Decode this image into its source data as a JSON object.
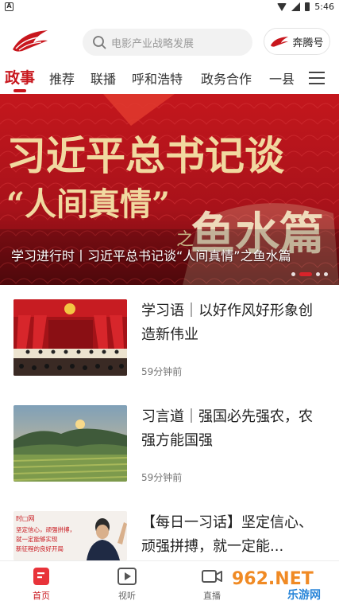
{
  "status_bar": {
    "carrier_badge": "A",
    "time": "5:46"
  },
  "header": {
    "search_placeholder": "电影产业战略发展",
    "benteng_label": "奔腾号"
  },
  "nav": {
    "tabs": [
      {
        "label": "政事",
        "active": true
      },
      {
        "label": "推荐",
        "active": false
      },
      {
        "label": "联播",
        "active": false
      },
      {
        "label": "呼和浩特",
        "active": false
      },
      {
        "label": "政务合作",
        "active": false
      },
      {
        "label": "一县",
        "active": false
      }
    ],
    "menu_icon": "menu-icon"
  },
  "banner": {
    "art_line1": "习近平总书记谈",
    "art_line2": "“人间真情”",
    "art_line3": "之",
    "art_line4": "鱼水篇",
    "caption": "学习进行时丨习近平总书记谈“人间真情”之鱼水篇",
    "dots_total": 4,
    "active_dot": 1
  },
  "news": [
    {
      "title": "学习语｜以好作风好形象创造新伟业",
      "time": "59分钟前",
      "thumb": "meeting-hall-photo"
    },
    {
      "title": "习言道｜强国必先强农，农强方能国强",
      "time": "59分钟前",
      "thumb": "farmland-photo"
    },
    {
      "title": "【每日一习话】坚定信心、顽强拼搏，就一定能...",
      "time": "",
      "thumb": "waving-photo"
    }
  ],
  "thumb3_text": {
    "brand": "时□网",
    "line1": "坚定信心，顽强拼搏，",
    "line2": "就一定能够实现",
    "line3": "新征程的良好开局"
  },
  "tabbar": {
    "tabs": [
      {
        "label": "首页",
        "icon": "home-icon",
        "active": true
      },
      {
        "label": "视听",
        "icon": "video-play-icon",
        "active": false
      },
      {
        "label": "直播",
        "icon": "live-camera-icon",
        "active": false
      }
    ]
  },
  "watermark": {
    "brand": "962.NET",
    "name": "乐游网"
  },
  "colors": {
    "accent": "#c8161d",
    "banner_bg": "#b0141a",
    "gold": "#f1d9a0"
  }
}
